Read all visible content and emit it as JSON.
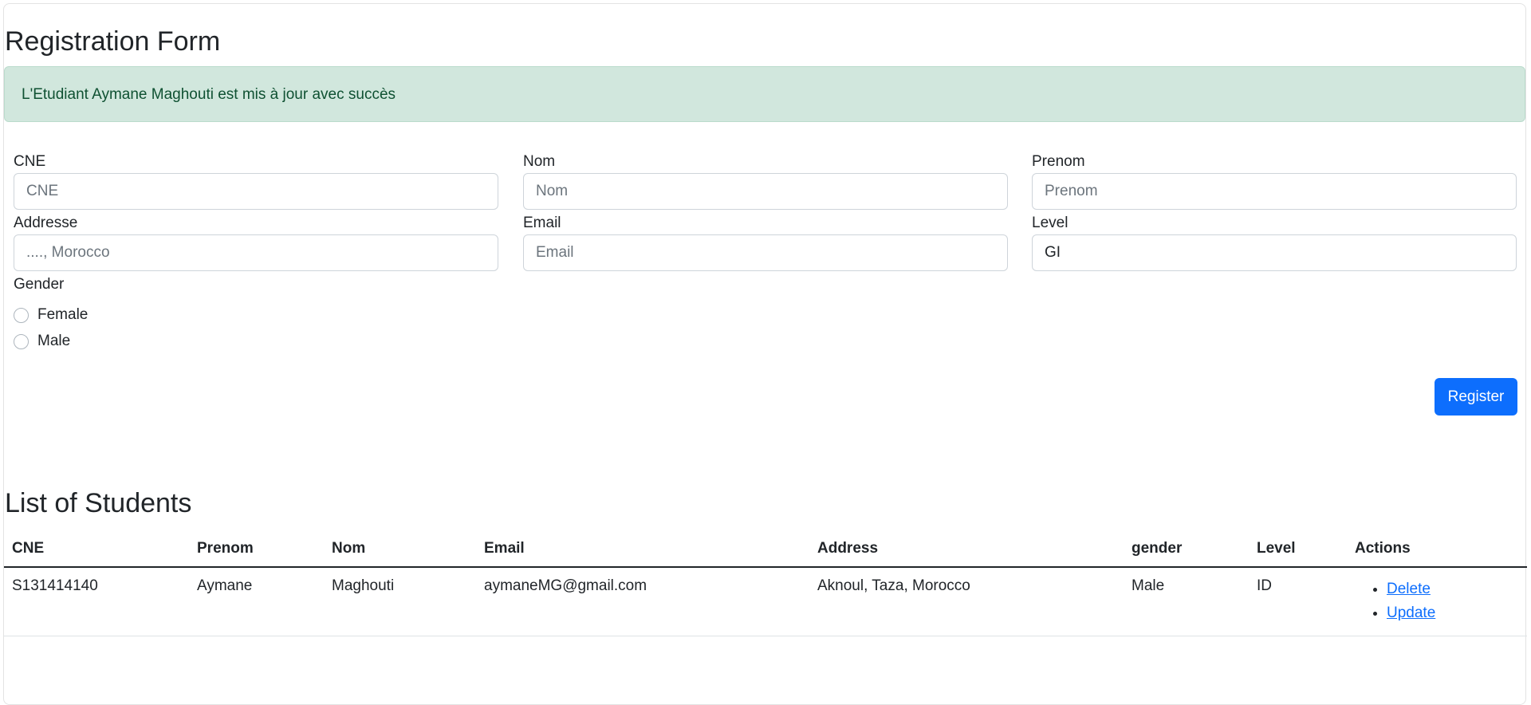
{
  "form": {
    "title": "Registration Form",
    "alert": "L'Etudiant Aymane Maghouti est mis à jour avec succès",
    "fields": {
      "cne": {
        "label": "CNE",
        "placeholder": "CNE",
        "value": ""
      },
      "nom": {
        "label": "Nom",
        "placeholder": "Nom",
        "value": ""
      },
      "prenom": {
        "label": "Prenom",
        "placeholder": "Prenom",
        "value": ""
      },
      "address": {
        "label": "Addresse",
        "placeholder": "...., Morocco",
        "value": ""
      },
      "email": {
        "label": "Email",
        "placeholder": "Email",
        "value": ""
      },
      "level": {
        "label": "Level",
        "placeholder": "",
        "value": "GI"
      }
    },
    "gender": {
      "label": "Gender",
      "options": [
        "Female",
        "Male"
      ]
    },
    "register_label": "Register"
  },
  "list": {
    "title": "List of Students",
    "columns": [
      "CNE",
      "Prenom",
      "Nom",
      "Email",
      "Address",
      "gender",
      "Level",
      "Actions"
    ],
    "rows": [
      {
        "cne": "S131414140",
        "prenom": "Aymane",
        "nom": "Maghouti",
        "email": "aymaneMG@gmail.com",
        "address": "Aknoul, Taza, Morocco",
        "gender": "Male",
        "level": "ID",
        "delete_label": "Delete",
        "update_label": "Update"
      }
    ]
  },
  "colors": {
    "primary": "#0d6efd",
    "alert_bg": "#d1e7dd",
    "alert_text": "#0f5132"
  }
}
